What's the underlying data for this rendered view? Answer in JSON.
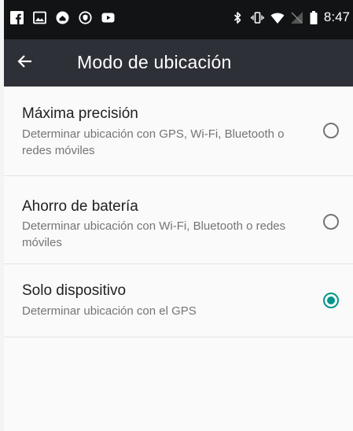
{
  "status_bar": {
    "time": "8:47",
    "left_icons": [
      "facebook-icon",
      "image-icon",
      "home-cloud-icon",
      "vpn-shield-icon",
      "youtube-icon"
    ],
    "right_icons": [
      "bluetooth-icon",
      "vibrate-icon",
      "wifi-icon",
      "signal-off-icon",
      "battery-icon"
    ]
  },
  "app_bar": {
    "title": "Modo de ubicación"
  },
  "options": [
    {
      "title": "Máxima precisión",
      "description": "Determinar ubicación con GPS, Wi-Fi, Bluetooth o redes móviles",
      "selected": false
    },
    {
      "title": "Ahorro de batería",
      "description": "Determinar ubicación con Wi-Fi, Bluetooth o redes móviles",
      "selected": false
    },
    {
      "title": "Solo dispositivo",
      "description": "Determinar ubicación con el GPS",
      "selected": true
    }
  ],
  "colors": {
    "status_bar": "#111315",
    "app_bar": "#2d3036",
    "accent": "#009688",
    "radio_off": "#757575"
  }
}
